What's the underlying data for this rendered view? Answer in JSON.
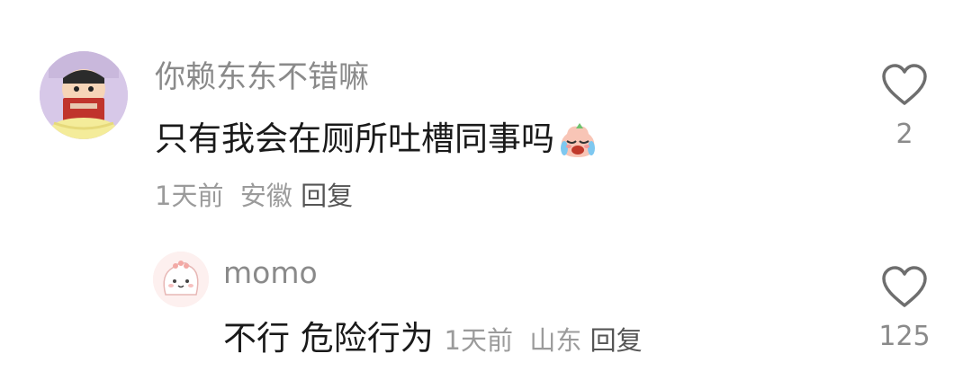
{
  "comments": [
    {
      "username": "你赖东东不错嘛",
      "text": "只有我会在厕所吐槽同事吗",
      "emoji": "crying-laughing-face",
      "time": "1天前",
      "location": "安徽",
      "reply_label": "回复",
      "like_count": "2"
    },
    {
      "username": "momo",
      "text": "不行 危险行为",
      "time": "1天前",
      "location": "山东",
      "reply_label": "回复",
      "like_count": "125"
    }
  ],
  "icons": {
    "like": "heart-outline-icon"
  },
  "colors": {
    "username": "#8a8a8a",
    "meta": "#9b9b9b",
    "reply": "#555555",
    "text": "#1a1a1a"
  }
}
